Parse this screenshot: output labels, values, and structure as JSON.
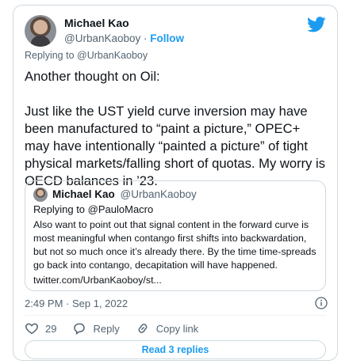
{
  "author": {
    "name": "Michael Kao",
    "handle": "@UrbanKaoboy",
    "separator": "·",
    "follow_label": "Follow"
  },
  "tweet": {
    "replying_to": "Replying to @UrbanKaoboy",
    "paragraph_1": "Another thought on Oil:",
    "paragraph_2": "Just like the UST yield curve inversion may have been manufactured to “paint a picture,” OPEC+ may have intentionally “painted a picture” of tight physical markets/falling short of quotas. My worry is OECD balances in ’23."
  },
  "quoted_tweet": {
    "name": "Michael Kao",
    "handle": "@UrbanKaoboy",
    "replying_prefix": "Replying to",
    "replying_mention": "@PauloMacro",
    "text": "Also want to point out that signal content in the forward curve is most meaningful when contango first shifts into backwardation, but not so much once it’s already there. By the time time-spreads go back into contango, decapitation will have happened.",
    "link": "twitter.com/UrbanKaoboy/st..."
  },
  "timestamp": "2:49 PM · Sep 1, 2022",
  "actions": {
    "like_count": "29",
    "reply_label": "Reply",
    "copy_link_label": "Copy link"
  },
  "read_replies_label": "Read 3 replies",
  "colors": {
    "accent": "#1d9bf0",
    "like": "#f91880",
    "muted_text": "#536471",
    "border": "#cfd9de"
  }
}
